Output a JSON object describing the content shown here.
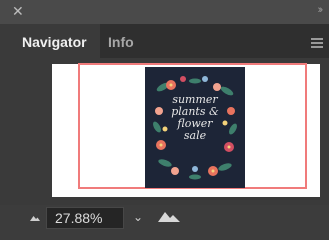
{
  "window": {
    "close_icon": "close-icon",
    "collapse_icon": "double-chevron-icon"
  },
  "tabs": [
    {
      "label": "Navigator",
      "active": true
    },
    {
      "label": "Info",
      "active": false
    }
  ],
  "panel_menu_icon": "hamburger-menu-icon",
  "preview": {
    "poster_text": [
      "summer",
      "plants &",
      "flower",
      "sale"
    ]
  },
  "zoom": {
    "value": "27.88%",
    "zoom_out_icon": "small-mountain-icon",
    "zoom_in_icon": "large-mountain-icon",
    "dropdown_icon": "chevron-down-icon"
  },
  "colors": {
    "panel_bg": "#3a3a3a",
    "view_rect": "#f07b7b",
    "poster_bg": "#1d2537"
  }
}
